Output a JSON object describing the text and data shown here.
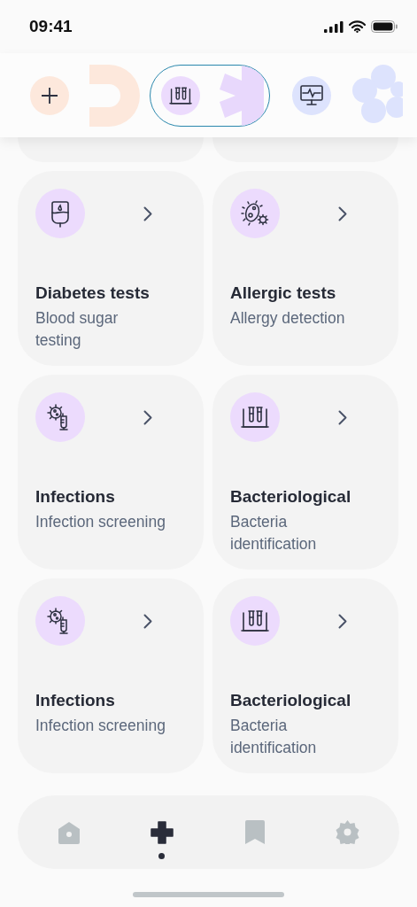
{
  "status_bar": {
    "time": "09:41"
  },
  "chips": [
    {
      "kind": "add",
      "selected": false
    },
    {
      "kind": "tubes",
      "selected": true
    },
    {
      "kind": "monitor",
      "selected": false
    }
  ],
  "cards": [
    {
      "kind": "drip",
      "title": "Diabetes tests",
      "subtitle": "Blood sugar testing"
    },
    {
      "kind": "bacteria",
      "title": "Allergic tests",
      "subtitle": "Allergy detection"
    },
    {
      "kind": "virus",
      "title": "Infections",
      "subtitle": "Infection screening"
    },
    {
      "kind": "tubes",
      "title": "Bacteriological",
      "subtitle": "Bacteria identification"
    },
    {
      "kind": "virus",
      "title": "Infections",
      "subtitle": "Infection screening"
    },
    {
      "kind": "tubes",
      "title": "Bacteriological",
      "subtitle": "Bacteria identification"
    }
  ],
  "nav": [
    {
      "kind": "home",
      "selected": false
    },
    {
      "kind": "medical",
      "selected": true
    },
    {
      "kind": "bookmark",
      "selected": false
    },
    {
      "kind": "settings",
      "selected": false
    }
  ]
}
